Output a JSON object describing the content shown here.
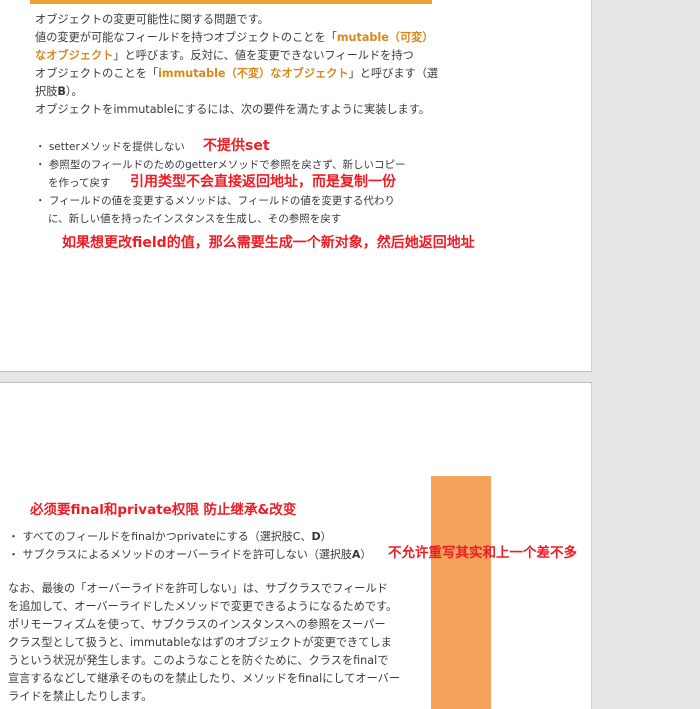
{
  "page1": {
    "line1": "オブジェクトの変更可能性に関する問題です。",
    "line2_a": "値の変更が可能なフィールドを持つオブジェクトのことを「",
    "line2_hl1": "mutable（可変）",
    "line3_hl": "なオブジェクト",
    "line3_b": "」と呼びます。反対に、値を変更できないフィールドを持つ",
    "line4_a": "オブジェクトのことを「",
    "line4_hl": "immutable（不変）なオブジェクト",
    "line4_b": "」と呼びます（選",
    "line5_a": "択肢",
    "line5_b": "B",
    "line5_c": "）。",
    "line6": "オブジェクトをimmutableにするには、次の要件を満たすように実装します。",
    "bullets": [
      "・ setterメソッドを提供しない",
      "・ 参照型のフィールドのためのgetterメソッドで参照を戻さず、新しいコピー",
      "を作って戻す",
      "・ フィールドの値を変更するメソッドは、フィールドの値を変更する代わり",
      "に、新しい値を持ったインスタンスを生成し、その参照を戻す"
    ],
    "notes": [
      "不提供set",
      "引用类型不会直接返回地址，而是复制一份",
      "如果想更改field的值，那么需要生成一个新对象，然后她返回地址"
    ]
  },
  "page2": {
    "note_top": "必须要final和private权限 防止继承&改变",
    "bullet1_a": "・ すべてのフィールドをfinalかつprivateにする（選択肢C、",
    "bullet1_b": "D",
    "bullet1_c": "）",
    "bullet2_a": "・ サブクラスによるメソッドのオーバーライドを許可しない（選択肢",
    "bullet2_b": "A",
    "bullet2_c": "）",
    "note_right": "不允许重写其实和上一个差不多",
    "para": [
      "なお、最後の「オーバーライドを許可しない」は、サブクラスでフィールド",
      "を追加して、オーバーライドしたメソッドで変更できるようになるためです。",
      "ポリモーフィズムを使って、サブクラスのインスタンスへの参照をスーパー",
      "クラス型として扱うと、immutableなはずのオブジェクトが変更できてしま",
      "うという状況が発生します。このようなことを防ぐために、クラスをfinalで",
      "宣言するなどして継承そのものを禁止したり、メソッドをfinalにしてオーバー",
      "ライドを禁止したりします。"
    ]
  }
}
